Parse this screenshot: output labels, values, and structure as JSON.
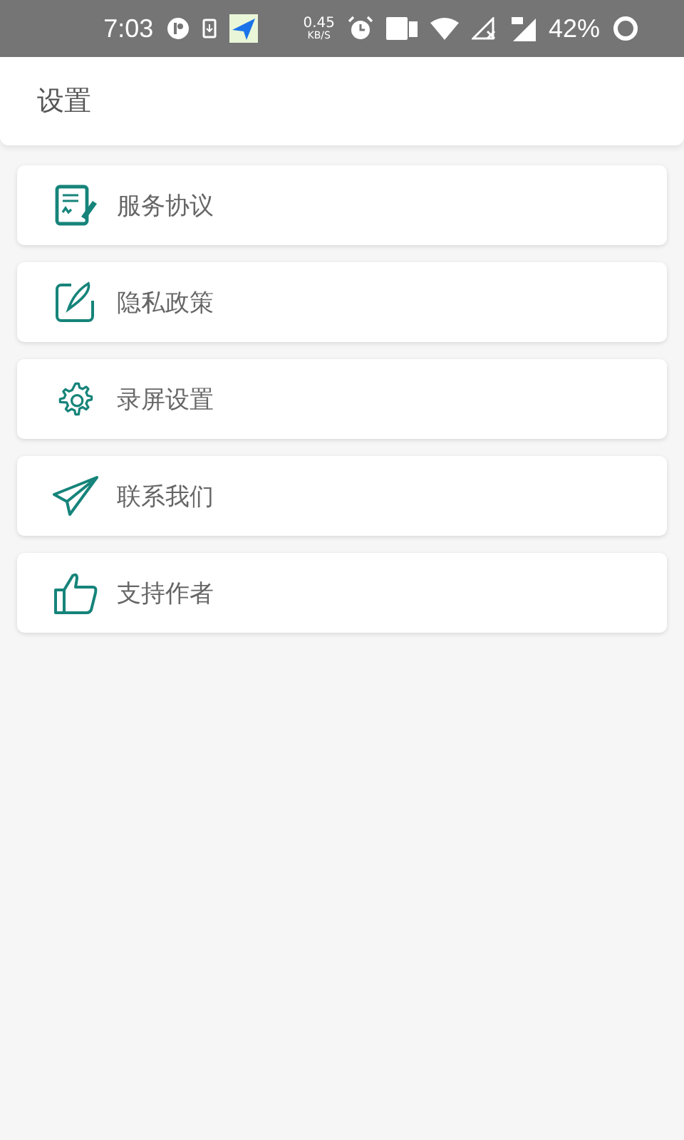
{
  "status_bar": {
    "time": "7:03",
    "speed": "0.45",
    "speed_unit": "KB/S",
    "battery": "42%"
  },
  "header": {
    "title": "设置"
  },
  "items": [
    {
      "kind": "agreement",
      "label": "服务协议"
    },
    {
      "kind": "privacy",
      "label": "隐私政策"
    },
    {
      "kind": "gear",
      "label": "录屏设置"
    },
    {
      "kind": "plane",
      "label": "联系我们"
    },
    {
      "kind": "thumb",
      "label": "支持作者"
    }
  ]
}
